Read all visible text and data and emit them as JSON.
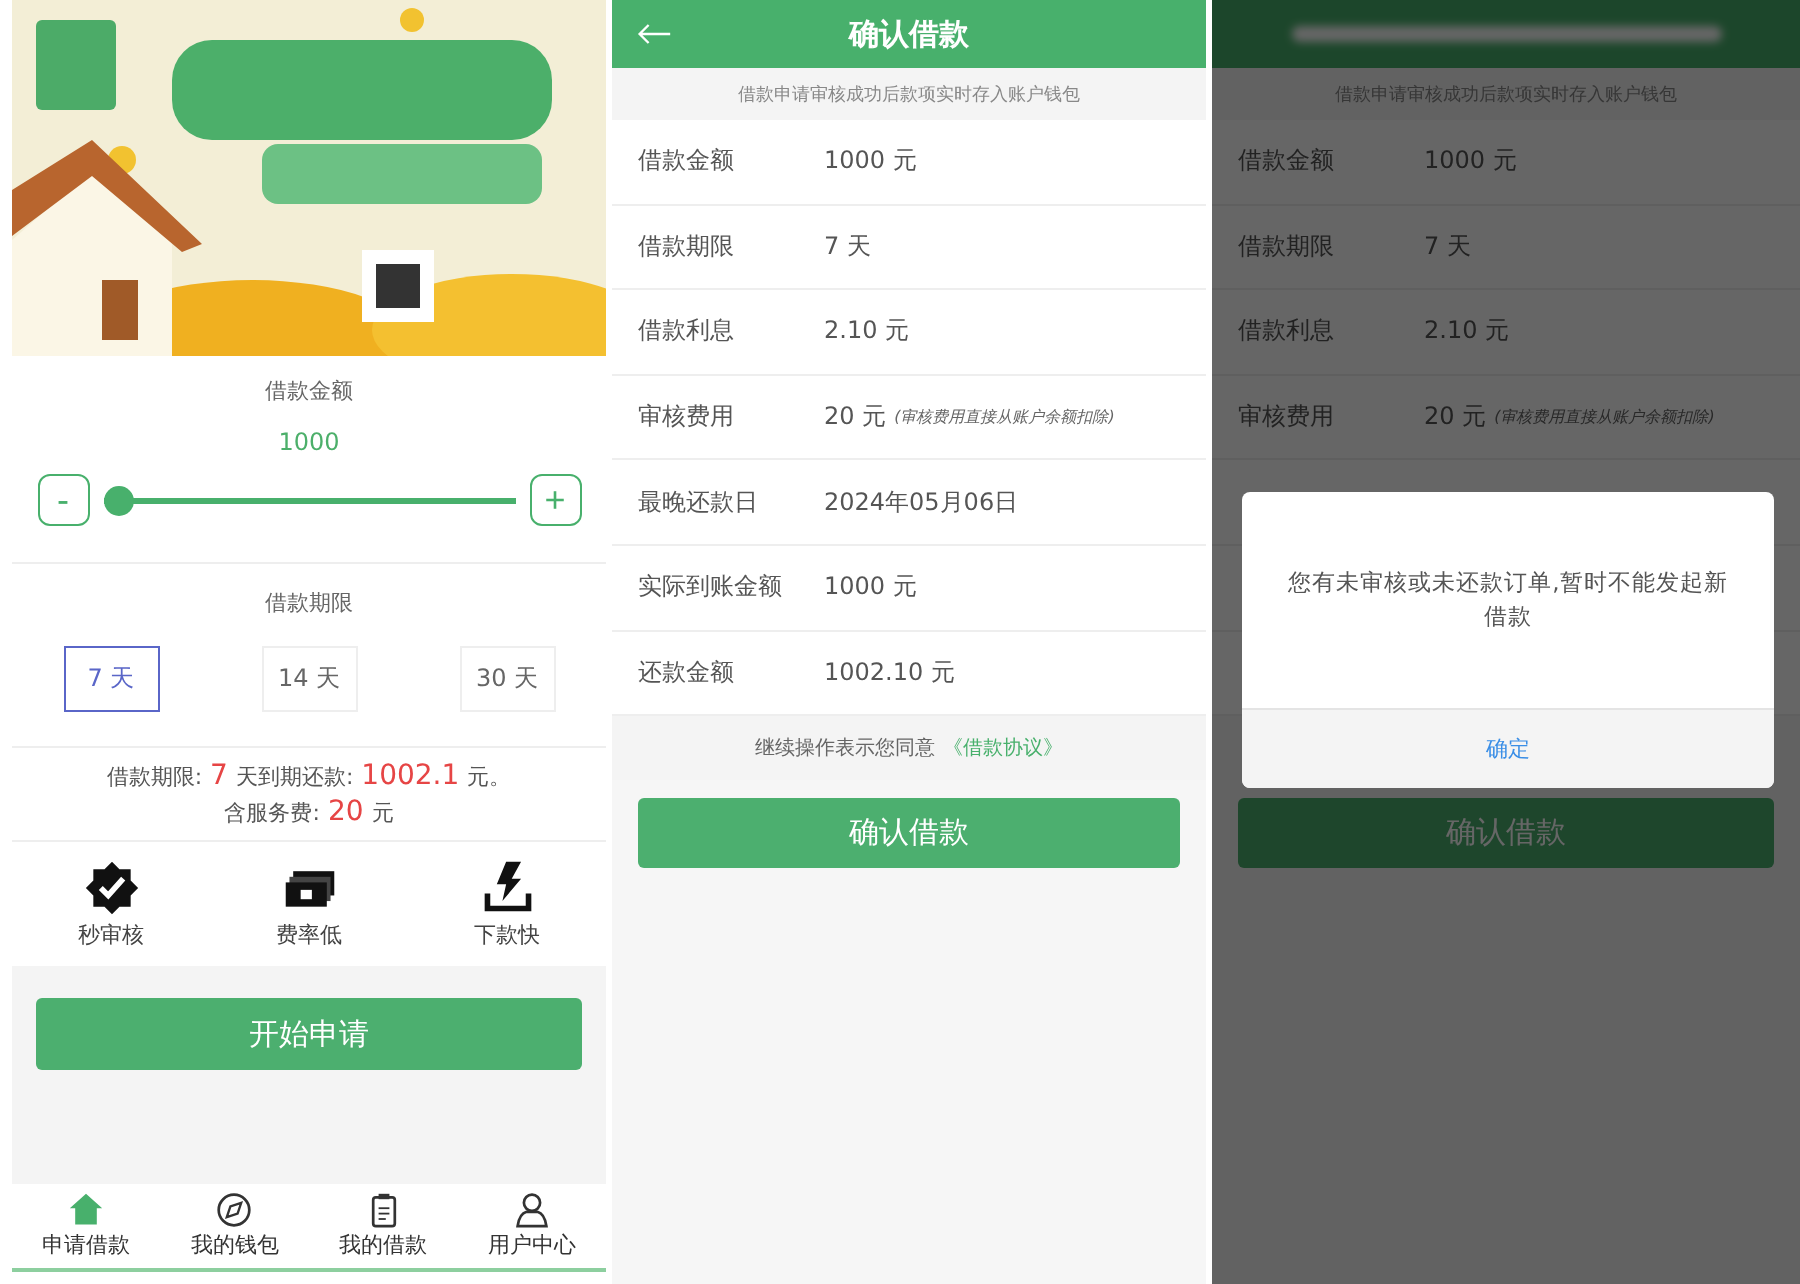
{
  "apply_screen": {
    "banner": {
      "kind": "picture"
    },
    "amount": {
      "label": "借款金额",
      "value": "1000",
      "minus": "-",
      "plus": "+",
      "level": 0
    },
    "term": {
      "label": "借款期限",
      "options": [
        {
          "label": "7 天",
          "selected": true
        },
        {
          "label": "14 天",
          "selected": false
        },
        {
          "label": "30 天",
          "selected": false
        }
      ]
    },
    "summary_lines": [
      [
        {
          "text": "借款期限:",
          "highlight": false
        },
        {
          "text": "7",
          "highlight": true
        },
        {
          "text": "天到期还款:",
          "highlight": false
        },
        {
          "text": "1002.1",
          "highlight": true
        },
        {
          "text": "元。",
          "highlight": false
        }
      ],
      [
        {
          "text": "含服务费:",
          "highlight": false
        },
        {
          "text": "20",
          "highlight": true
        },
        {
          "text": "元",
          "highlight": false
        }
      ]
    ],
    "features": [
      {
        "kind": "badge",
        "label": "秒审核"
      },
      {
        "kind": "money",
        "label": "费率低"
      },
      {
        "kind": "download",
        "label": "下款快"
      }
    ],
    "start_button": "开始申请",
    "tabs": [
      {
        "kind": "home",
        "label": "申请借款",
        "selected": true
      },
      {
        "kind": "compass",
        "label": "我的钱包",
        "selected": false
      },
      {
        "kind": "clipboard",
        "label": "我的借款",
        "selected": false
      },
      {
        "kind": "user",
        "label": "用户中心",
        "selected": false
      }
    ]
  },
  "confirm_screen": {
    "title": "确认借款",
    "notice": "借款申请审核成功后款项实时存入账户钱包",
    "rows": [
      {
        "label": "借款金额",
        "value": "1000 元"
      },
      {
        "label": "借款期限",
        "value": "7 天"
      },
      {
        "label": "借款利息",
        "value": "2.10 元"
      },
      {
        "label": "审核费用",
        "value": "20 元",
        "note": "(审核费用直接从账户余额扣除)"
      },
      {
        "label": "最晚还款日",
        "value": "2024年05月06日"
      },
      {
        "label": "实际到账金额",
        "value": "1000 元"
      },
      {
        "label": "还款金额",
        "value": "1002.10 元"
      }
    ],
    "agreement": {
      "text": "继续操作表示您同意",
      "link": "《借款协议》"
    },
    "button": "确认借款"
  },
  "dialog_screen": {
    "notice": "借款申请审核成功后款项实时存入账户钱包",
    "rows": [
      {
        "label": "借款金额",
        "value": "1000 元"
      },
      {
        "label": "借款期限",
        "value": "7 天"
      },
      {
        "label": "借款利息",
        "value": "2.10 元"
      },
      {
        "label": "审核费用",
        "value": "20 元",
        "note": "(审核费用直接从账户余额扣除)"
      }
    ],
    "button": "确认借款",
    "dialog": {
      "message": "您有未审核或未还款订单,暂时不能发起新借款",
      "ok": "确定"
    }
  }
}
